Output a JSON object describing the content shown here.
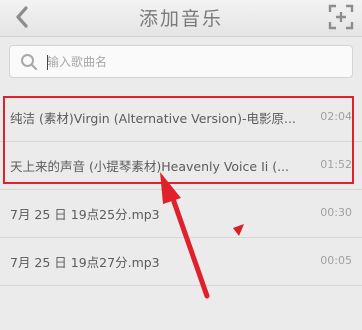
{
  "header": {
    "title": "添加音乐",
    "back_icon": "chevron-left-icon",
    "scan_icon": "scan-icon"
  },
  "search": {
    "placeholder": "输入歌曲名",
    "icon": "search-icon"
  },
  "songs": [
    {
      "name": "纯洁 (素材)Virgin (Alternative Version)-电影原...",
      "duration": "02:04"
    },
    {
      "name": "天上来的声音 (小提琴素材)Heavenly Voice Ii (...",
      "duration": "01:52"
    },
    {
      "name": "7月 25 日 19点25分.mp3",
      "duration": "00:30"
    },
    {
      "name": "7月 25 日 19点27分.mp3",
      "duration": "00:05"
    }
  ],
  "annotation": {
    "highlight_color": "#e0202a",
    "arrow_color": "#e0202a"
  }
}
